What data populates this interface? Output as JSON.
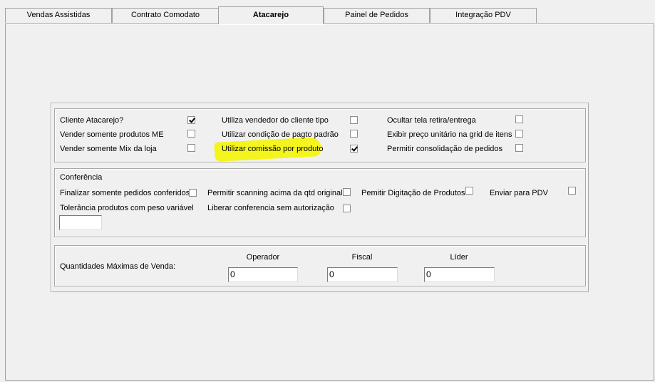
{
  "tabs": [
    {
      "label": "Vendas Assistidas",
      "active": false
    },
    {
      "label": "Contrato Comodato",
      "active": false
    },
    {
      "label": "Atacarejo",
      "active": true
    },
    {
      "label": "Painel de Pedidos",
      "active": false
    },
    {
      "label": "Integração PDV",
      "active": false
    }
  ],
  "options": {
    "cliente_atacarejo": {
      "label": "Cliente Atacarejo?",
      "checked": true
    },
    "vender_produtos_me": {
      "label": "Vender somente produtos ME",
      "checked": false
    },
    "vender_mix_loja": {
      "label": "Vender somente Mix da loja",
      "checked": false
    },
    "vendedor_cliente_tipo": {
      "label": "Utiliza vendedor do cliente tipo",
      "checked": false
    },
    "condicao_pagto_padrao": {
      "label": "Utilizar condição de pagto padrão",
      "checked": false
    },
    "comissao_por_produto": {
      "label": "Utilizar comissão por produto",
      "checked": true
    },
    "ocultar_retira_entrega": {
      "label": "Ocultar tela retira/entrega",
      "checked": false
    },
    "exibir_preco_unitario": {
      "label": "Exibir preço unitário na grid de itens",
      "checked": false
    },
    "consolidacao_pedidos": {
      "label": "Permitir consolidação de pedidos",
      "checked": false
    }
  },
  "conferencia": {
    "title": "Conferência",
    "finalizar_conferidos": {
      "label": "Finalizar somente pedidos conferidos",
      "checked": false
    },
    "scanning_acima": {
      "label": "Permitir scanning acima da qtd original",
      "checked": false
    },
    "digitacao_produtos": {
      "label": "Pemitir Digitação de Produtos",
      "checked": false
    },
    "enviar_pdv": {
      "label": "Enviar para PDV",
      "checked": false
    },
    "tolerancia_label": "Tolerância produtos com peso variável",
    "tolerancia_value": "",
    "liberar_sem_autorizacao": {
      "label": "Liberar conferencia sem autorização",
      "checked": false
    }
  },
  "quantidades": {
    "label": "Quantidades Máximas de Venda:",
    "operador_label": "Operador",
    "operador_value": "0",
    "fiscal_label": "Fiscal",
    "fiscal_value": "0",
    "lider_label": "Líder",
    "lider_value": "0"
  }
}
